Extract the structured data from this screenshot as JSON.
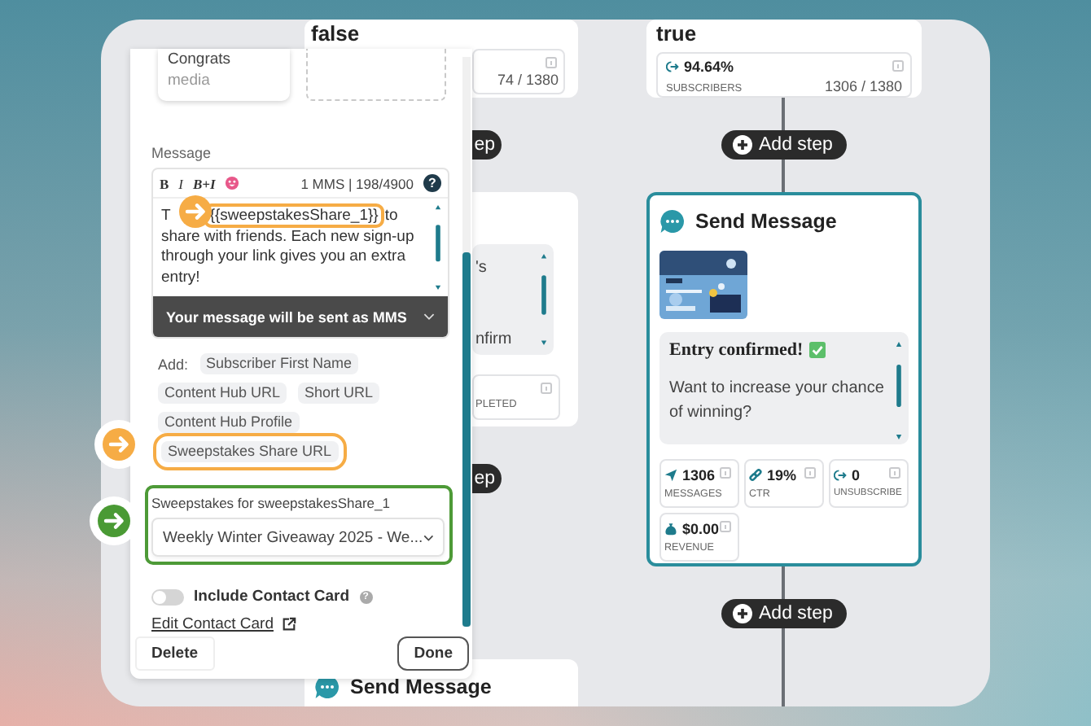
{
  "canvas": {
    "false_branch": {
      "title": "false",
      "count": "74 / 1380",
      "add_steps": [
        "ep",
        "ep"
      ],
      "message_fragments": [
        "'s",
        "nfirm"
      ],
      "stat_fragment": "PLETED",
      "next_step": "Send Message"
    },
    "true_branch": {
      "title": "true",
      "stat": {
        "value": "94.64%",
        "label": "SUBSCRIBERS",
        "count": "1306 / 1380"
      },
      "add_steps": [
        "Add step",
        "Add step"
      ],
      "step": {
        "title": "Send Message",
        "preview": {
          "heading": "Entry confirmed!",
          "body": "Want to increase your chance of winning?"
        },
        "stats": [
          {
            "kind": "send",
            "value": "1306",
            "label": "MESSAGES"
          },
          {
            "kind": "link",
            "value": "19%",
            "label": "CTR"
          },
          {
            "kind": "exit",
            "value": "0",
            "label": "UNSUBSCRIBE"
          },
          {
            "kind": "money",
            "value": "$0.00",
            "label": "REVENUE"
          }
        ]
      }
    }
  },
  "editor": {
    "media_card": {
      "title": "Congrats",
      "subtitle": "media"
    },
    "message": {
      "label": "Message",
      "toolbar": [
        "B",
        "I",
        "B+I"
      ],
      "counter": "1 MMS | 198/4900",
      "help": "?",
      "text_start": "T",
      "token": "{{sweepstakesShare_1}}",
      "text_rest": "to share with friends. Each new sign-up through your link gives you an extra entry!",
      "notice": "Your message will be sent as MMS"
    },
    "insert": {
      "label": "Add:",
      "chips": [
        {
          "label": "Subscriber First Name",
          "highlighted": false
        },
        {
          "label": "Content Hub URL",
          "highlighted": false
        },
        {
          "label": "Short URL",
          "highlighted": false
        },
        {
          "label": "Content Hub Profile",
          "highlighted": false
        },
        {
          "label": "Sweepstakes Share URL",
          "highlighted": true
        }
      ]
    },
    "sweepstakes": {
      "label": "Sweepstakes for sweepstakesShare_1",
      "value": "Weekly Winter Giveaway 2025 - We...",
      "highlighted": true
    },
    "contact_card": {
      "label": "Include Contact Card",
      "on": false,
      "help": "?",
      "link": "Edit Contact Card"
    },
    "buttons": [
      {
        "label": "Delete",
        "kind": "secondary"
      },
      {
        "label": "Done",
        "kind": "primary"
      }
    ]
  },
  "annotations": [
    {
      "color": "#f6ac45",
      "halo": false
    },
    {
      "color": "#f6ac45",
      "halo": true
    },
    {
      "color": "#4a9a34",
      "halo": true
    }
  ]
}
